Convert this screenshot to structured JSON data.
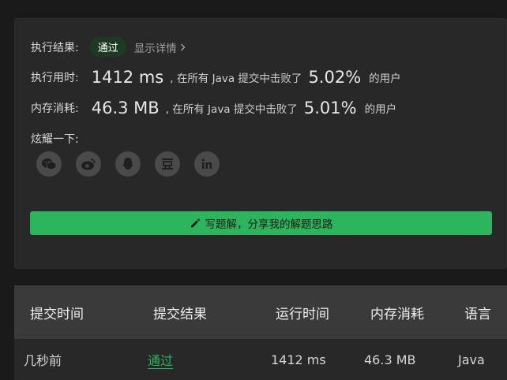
{
  "result": {
    "label": "执行结果:",
    "status": "通过",
    "details_link": "显示详情"
  },
  "runtime": {
    "label": "执行用时:",
    "value": "1412 ms",
    "prefix": ", 在所有 Java 提交中击败了",
    "percent": "5.02%",
    "suffix": "的用户"
  },
  "memory": {
    "label": "内存消耗:",
    "value": "46.3 MB",
    "prefix": ", 在所有 Java 提交中击败了",
    "percent": "5.01%",
    "suffix": "的用户"
  },
  "share": {
    "label": "炫耀一下:",
    "icons": [
      "wechat-icon",
      "weibo-icon",
      "qq-icon",
      "douban-icon",
      "linkedin-icon"
    ]
  },
  "write_button": "写题解，分享我的解题思路",
  "table": {
    "headers": [
      "提交时间",
      "提交结果",
      "运行时间",
      "内存消耗",
      "语言"
    ],
    "rows": [
      [
        "几秒前",
        "通过",
        "1412 ms",
        "46.3 MB",
        "Java"
      ]
    ]
  },
  "colors": {
    "accent": "#2db55d",
    "card": "#282828",
    "background": "#1a1a1a"
  }
}
